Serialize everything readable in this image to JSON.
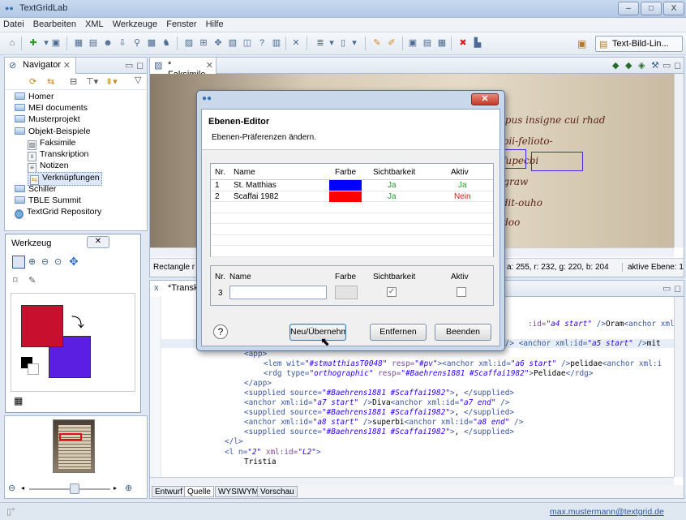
{
  "window": {
    "title": "TextGridLab",
    "controls": [
      "–",
      "□",
      "X"
    ]
  },
  "menu": [
    "Datei",
    "Bearbeiten",
    "XML",
    "Werkzeuge",
    "Fenster",
    "Hilfe"
  ],
  "toolbar": {
    "perspective": "Text-Bild-Lin..."
  },
  "navigator": {
    "tab": "Navigator",
    "items": [
      {
        "label": "Homer",
        "type": "folder",
        "indent": 0
      },
      {
        "label": "MEI documents",
        "type": "folder",
        "indent": 0
      },
      {
        "label": "Musterprojekt",
        "type": "folder",
        "indent": 0
      },
      {
        "label": "Objekt-Beispiele",
        "type": "folder",
        "indent": 0
      },
      {
        "label": "Faksimile",
        "type": "image",
        "indent": 1
      },
      {
        "label": "Transkription",
        "type": "xml",
        "indent": 1
      },
      {
        "label": "Notizen",
        "type": "file",
        "indent": 1
      },
      {
        "label": "Verknüpfungen",
        "type": "link",
        "indent": 1,
        "selected": true
      },
      {
        "label": "Schiller",
        "type": "folder",
        "indent": 0
      },
      {
        "label": "TBLE Summit",
        "type": "folder",
        "indent": 0
      },
      {
        "label": "TextGrid Repository",
        "type": "repo",
        "indent": 0
      }
    ]
  },
  "werkzeug": {
    "title": "Werkzeug",
    "fg_color": "#c8102e",
    "bg_color": "#5a1fe0"
  },
  "faksimile": {
    "tab": "* Faksimile",
    "status_left": "Rectangle r",
    "status_color": "a: 255, r: 232, g: 220, b: 204",
    "status_layer": "aktive Ebene: 1",
    "manuscript_lines": [
      "mm opus insigne cui rhad",
      "Phuopii-felioto-",
      "....ia fupecbi",
      "pera graw",
      "..adodit-ouho",
      "..hendoo"
    ]
  },
  "editor": {
    "tab": "*Transkri",
    "code_lines": [
      {
        "indent": 0,
        "html": ""
      },
      {
        "indent": 0,
        "html": ""
      },
      {
        "indent": 0,
        "html": "<span class='attr'>:id=</span><span class='val'>\"a4 start\"</span><span class='tag'> /&gt;</span><span class='txt'>Oram</span><span class='tag'>&lt;anchor xml:id=</span><span class='val'>\"</span>"
      },
      {
        "indent": 0,
        "html": ""
      },
      {
        "indent": 0,
        "html": "<span class='tag'>&lt;anchor xml:id=</span><span class='val'>\"a5 start\"</span><span class='tag'> /&gt;</span><span class='txt'>pande</span><span class='tag'>&lt;anchor xml:id=</span><span class='val'>\"a5 end\"</span><span class='tag'> /&gt; &lt;anchor xml:id=</span><span class='val'>\"a5 start\"</span><span class='tag'> /&gt;</span><span class='txt'>mit</span>"
      },
      {
        "indent": 0,
        "html": "<span class='tag'>&lt;app&gt;</span>"
      },
      {
        "indent": 1,
        "html": "<span class='tag'>&lt;lem wit=</span><span class='val'>\"#stmatthiasT0048\"</span><span class='attr'> resp=</span><span class='val'>\"#pv\"</span><span class='tag'>&gt;&lt;anchor xml:id=</span><span class='val'>\"a6 start\"</span><span class='tag'> /&gt;</span><span class='txt'>pelidae</span><span class='tag'>&lt;anchor xml:i</span>"
      },
      {
        "indent": 1,
        "html": "<span class='tag'>&lt;rdg type=</span><span class='val'>\"orthographic\"</span><span class='attr'> resp=</span><span class='val'>\"#Baehrens1881 #Scaffai1982\"</span><span class='tag'>&gt;</span><span class='txt'>Pelidae</span><span class='tag'>&lt;/rdg&gt;</span>"
      },
      {
        "indent": 0,
        "html": "<span class='tag'>&lt;/app&gt;</span>"
      },
      {
        "indent": 0,
        "html": "<span class='tag'>&lt;supplied source=</span><span class='val'>\"#Baehrens1881 #Scaffai1982\"</span><span class='tag'>&gt;</span><span class='txt'>, </span><span class='tag'>&lt;/supplied&gt;</span>"
      },
      {
        "indent": 0,
        "html": "<span class='tag'>&lt;anchor xml:id=</span><span class='val'>\"a7 start\"</span><span class='tag'> /&gt;</span><span class='txt'>Diva</span><span class='tag'>&lt;anchor xml:id=</span><span class='val'>\"a7 end\"</span><span class='tag'> /&gt;</span>"
      },
      {
        "indent": 0,
        "html": "<span class='tag'>&lt;supplied source=</span><span class='val'>\"#Baehrens1881 #Scaffai1982\"</span><span class='tag'>&gt;</span><span class='txt'>, </span><span class='tag'>&lt;/supplied&gt;</span>"
      },
      {
        "indent": 0,
        "html": "<span class='tag'>&lt;anchor xml:id=</span><span class='val'>\"a8 start\"</span><span class='tag'> /&gt;</span><span class='txt'>superbi</span><span class='tag'>&lt;anchor xml:id=</span><span class='val'>\"a8 end\"</span><span class='tag'> /&gt;</span>"
      },
      {
        "indent": 0,
        "html": "<span class='tag'>&lt;supplied source=</span><span class='val'>\"#Baehrens1881 #Scaffai1982\"</span><span class='tag'>&gt;</span><span class='txt'>, </span><span class='tag'>&lt;/supplied&gt;</span>"
      },
      {
        "indent": -1,
        "html": "<span class='tag'>&lt;/l&gt;</span>"
      },
      {
        "indent": -1,
        "html": "<span class='tag'>&lt;l n=</span><span class='val'>\"2\"</span><span class='attr'> xml:id=</span><span class='val'>\"L2\"</span><span class='tag'>&gt;</span>"
      },
      {
        "indent": 0,
        "html": "<span class='txt'>Tristia</span>"
      }
    ],
    "bottom_tabs": [
      "Entwurf",
      "Quelle",
      "WYSIWYM",
      "Vorschau"
    ],
    "active_tab": "Quelle"
  },
  "dialog": {
    "title": "Ebenen-Editor",
    "subtitle": "Ebenen-Präferenzen ändern.",
    "columns": [
      "Nr.",
      "Name",
      "Farbe",
      "Sichtbarkeit",
      "Aktiv"
    ],
    "rows": [
      {
        "nr": "1",
        "name": "St. Matthias",
        "color": "#0000ff",
        "visible": "Ja",
        "active": "Ja",
        "active_color": "#2a9d2a"
      },
      {
        "nr": "2",
        "name": "Scaffai 1982",
        "color": "#ff0000",
        "visible": "Ja",
        "active": "Nein",
        "active_color": "#e01919"
      }
    ],
    "new_row": {
      "labels": [
        "Nr.",
        "Name",
        "Farbe",
        "Sichtbarkeit",
        "Aktiv"
      ],
      "nr": "3",
      "name_value": "",
      "visible_checked": true,
      "active_checked": false
    },
    "buttons": {
      "help": "?",
      "new": "Neu/Übernehmen",
      "remove": "Entfernen",
      "quit": "Beenden"
    }
  },
  "status": {
    "user": "max.mustermann@textgrid.de"
  }
}
